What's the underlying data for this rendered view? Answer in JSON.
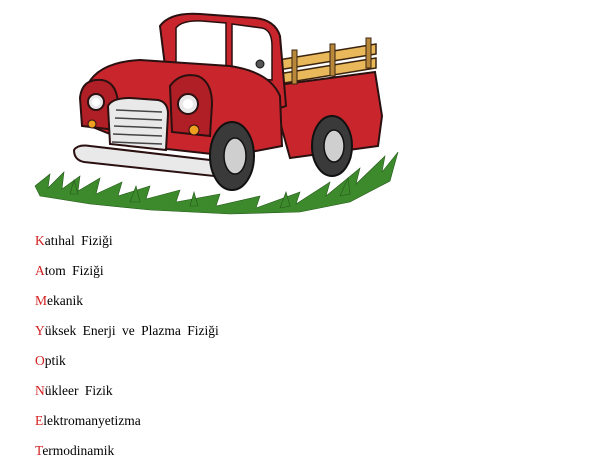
{
  "image": {
    "subject": "red-pickup-truck-illustration",
    "colors": {
      "body_red": "#c8262c",
      "dark_red": "#8e1a1e",
      "chrome": "#e9e9e9",
      "wood": "#e8b85a",
      "tire": "#3a3a3a",
      "grass": "#3d8a2c"
    }
  },
  "list": {
    "accent_color": "#d42020",
    "items": [
      {
        "initial": "K",
        "rest": "atıhal  Fiziği"
      },
      {
        "initial": "A",
        "rest": "tom  Fiziği"
      },
      {
        "initial": "M",
        "rest": "ekanik"
      },
      {
        "initial": "Y",
        "rest": "üksek  Enerji  ve  Plazma  Fiziği"
      },
      {
        "initial": "O",
        "rest": "ptik"
      },
      {
        "initial": "N",
        "rest": "ükleer  Fizik"
      },
      {
        "initial": "E",
        "rest": "lektromanyetizma"
      },
      {
        "initial": "T",
        "rest": "ermodinamik"
      }
    ]
  }
}
